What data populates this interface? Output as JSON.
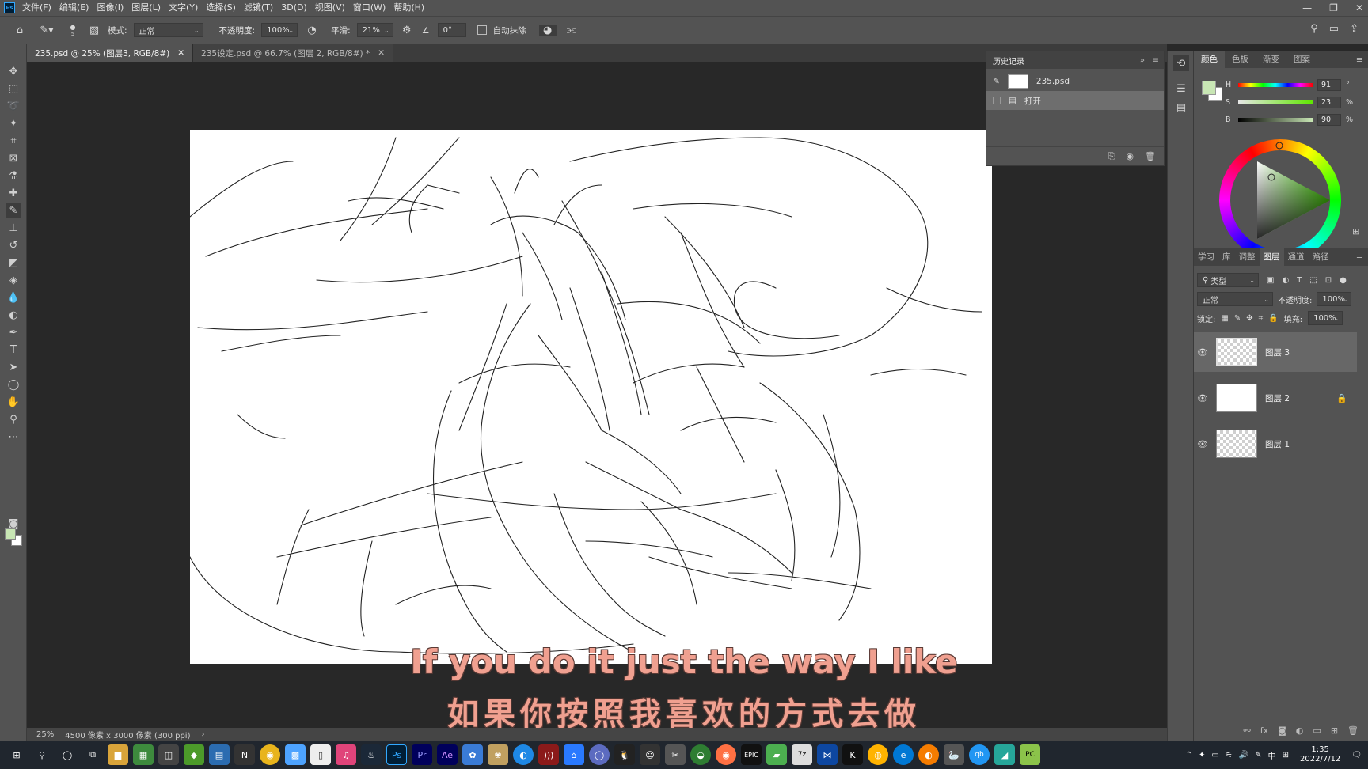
{
  "menubar": {
    "logo": "Ps",
    "items": [
      "文件(F)",
      "编辑(E)",
      "图像(I)",
      "图层(L)",
      "文字(Y)",
      "选择(S)",
      "滤镜(T)",
      "3D(D)",
      "视图(V)",
      "窗口(W)",
      "帮助(H)"
    ]
  },
  "options": {
    "brush_size": "5",
    "mode_label": "模式:",
    "mode_value": "正常",
    "opacity_label": "不透明度:",
    "opacity_value": "100%",
    "smoothing_label": "平滑:",
    "smoothing_value": "21%",
    "angle_value": "0°",
    "auto_erase_label": "自动抹除"
  },
  "tabs": [
    {
      "label": "235.psd @ 25% (图层3, RGB/8#)"
    },
    {
      "label": "235设定.psd @ 66.7% (图层 2, RGB/8#) *"
    }
  ],
  "history": {
    "title": "历史记录",
    "snapshot": "235.psd",
    "step": "打开"
  },
  "color_panel": {
    "tabs": [
      "颜色",
      "色板",
      "渐变",
      "图案"
    ],
    "h_label": "H",
    "h_value": "91",
    "h_unit": "°",
    "s_label": "S",
    "s_value": "23",
    "s_unit": "%",
    "b_label": "B",
    "b_value": "90",
    "b_unit": "%",
    "foreground_color": "#c8e6b4"
  },
  "layers_panel": {
    "tabs": [
      "学习",
      "库",
      "调整",
      "图层",
      "通道",
      "路径"
    ],
    "filter_value": "类型",
    "blend_mode": "正常",
    "opacity_label": "不透明度:",
    "opacity_value": "100%",
    "lock_label": "锁定:",
    "fill_label": "填充:",
    "fill_value": "100%",
    "layers": [
      {
        "name": "图层 3"
      },
      {
        "name": "图层 2"
      },
      {
        "name": "图层 1"
      }
    ]
  },
  "status": {
    "zoom": "25%",
    "doc_info": "4500 像素 x 3000 像素 (300 ppi)"
  },
  "subtitles": {
    "english": "If you do it just the way I like",
    "chinese": "如果你按照我喜欢的方式去做"
  },
  "taskbar": {
    "time": "1:35",
    "date": "2022/7/12",
    "ime": "中"
  }
}
